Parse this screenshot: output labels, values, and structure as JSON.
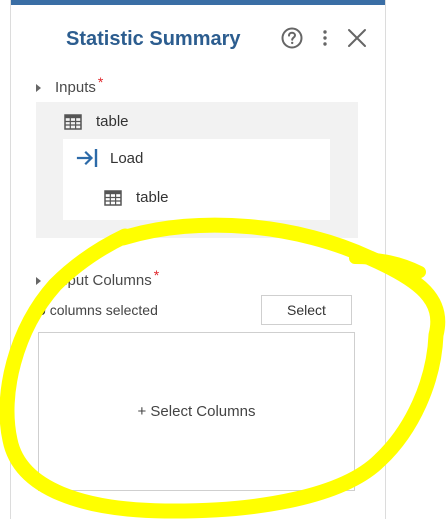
{
  "panel": {
    "title": "Statistic Summary",
    "accent_color": "#3a6ea5",
    "title_color": "#2c5d8f",
    "required_marker": "*",
    "required_color": "#e0262b"
  },
  "header_icons": [
    "help-circle-icon",
    "more-vertical-icon",
    "close-icon"
  ],
  "inputs": {
    "label": "Inputs",
    "items": [
      {
        "icon": "table-grid-icon",
        "label": "table"
      },
      {
        "icon": "load-arrow-icon",
        "label": "Load"
      },
      {
        "icon": "table-grid-icon",
        "label": "table"
      }
    ]
  },
  "input_columns": {
    "label": "Input Columns",
    "count": "0",
    "count_suffix": "columns selected",
    "select_label": "Select",
    "add_label": "+ Select Columns"
  },
  "annotation": {
    "color": "#ffff00",
    "shape": "hand-drawn circle around Input Columns section"
  }
}
